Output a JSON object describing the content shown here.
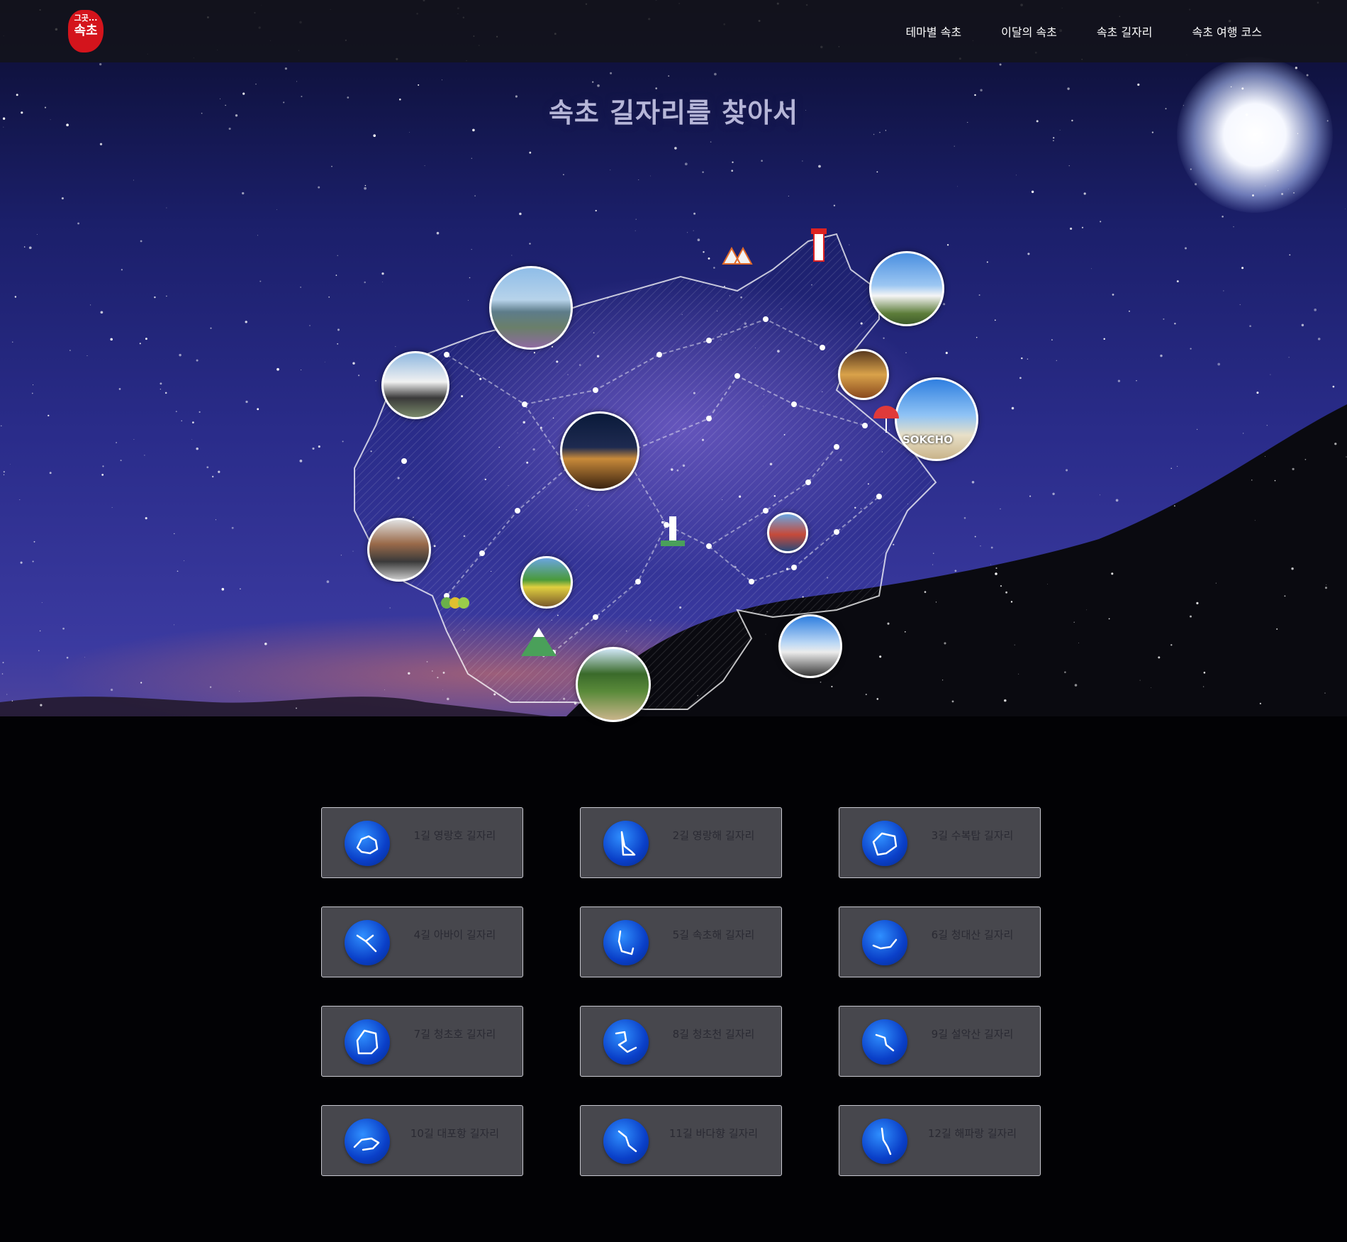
{
  "logo": {
    "text_top": "그곳...",
    "text_bottom": "속초"
  },
  "nav": {
    "items": [
      "테마별 속초",
      "이달의 속초",
      "속초 길자리",
      "속초 여행 코스"
    ]
  },
  "page": {
    "title": "속초 길자리를 찾아서"
  },
  "map": {
    "badge_text": "SOKCHO"
  },
  "routes": [
    {
      "label": "1길 영랑호 길자리",
      "icon": "constellation-1-icon"
    },
    {
      "label": "2길 영랑해 길자리",
      "icon": "constellation-2-icon"
    },
    {
      "label": "3길 수복탑 길자리",
      "icon": "constellation-3-icon"
    },
    {
      "label": "4길 아바이 길자리",
      "icon": "constellation-4-icon"
    },
    {
      "label": "5길 속초해 길자리",
      "icon": "constellation-5-icon"
    },
    {
      "label": "6길 청대산 길자리",
      "icon": "constellation-6-icon"
    },
    {
      "label": "7길 청초호 길자리",
      "icon": "constellation-7-icon"
    },
    {
      "label": "8길 청초천 길자리",
      "icon": "constellation-8-icon"
    },
    {
      "label": "9길 설악산 길자리",
      "icon": "constellation-9-icon"
    },
    {
      "label": "10길 대포항 길자리",
      "icon": "constellation-10-icon"
    },
    {
      "label": "11길 바다향 길자리",
      "icon": "constellation-11-icon"
    },
    {
      "label": "12길 해파랑 길자리",
      "icon": "constellation-12-icon"
    }
  ],
  "colors": {
    "header_bg": "#141418",
    "icon_blue": "#0a3fc8",
    "card_bg": "#8c8c96",
    "logo_red": "#d4141c"
  }
}
